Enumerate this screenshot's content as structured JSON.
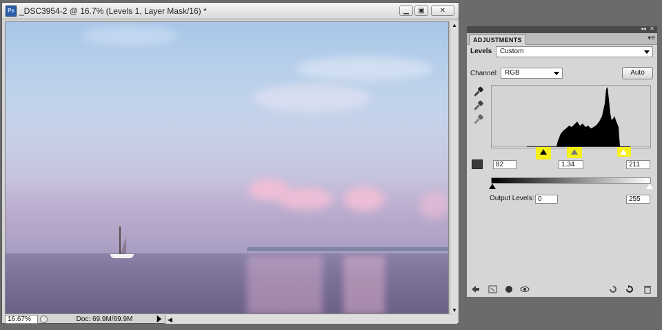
{
  "document": {
    "app_icon": "Ps",
    "title": "_DSC3954-2 @ 16.7% (Levels 1, Layer Mask/16) *",
    "zoom": "16.67%",
    "doc_info": "Doc: 69.9M/69.9M",
    "icons": {
      "minimize": "minimize-icon",
      "restore": "restore-icon",
      "close": "close-icon"
    }
  },
  "panel": {
    "tab": "ADJUSTMENTS",
    "adjustment_label": "Levels",
    "preset_value": "Custom",
    "channel_label": "Channel:",
    "channel_value": "RGB",
    "auto_label": "Auto",
    "input_black": "82",
    "input_gamma": "1.34",
    "input_white": "211",
    "output_label": "Output Levels:",
    "output_black": "0",
    "output_white": "255",
    "bottom_icons": [
      "back-arrow-icon",
      "clip-layer-icon",
      "mask-view-icon",
      "eye-icon",
      "reset-previous-icon",
      "reset-icon",
      "trash-icon"
    ]
  },
  "colors": {
    "highlight": "#f5ef1a",
    "panel_bg": "#d6d6d6",
    "workspace_bg": "#6b6b6b"
  }
}
